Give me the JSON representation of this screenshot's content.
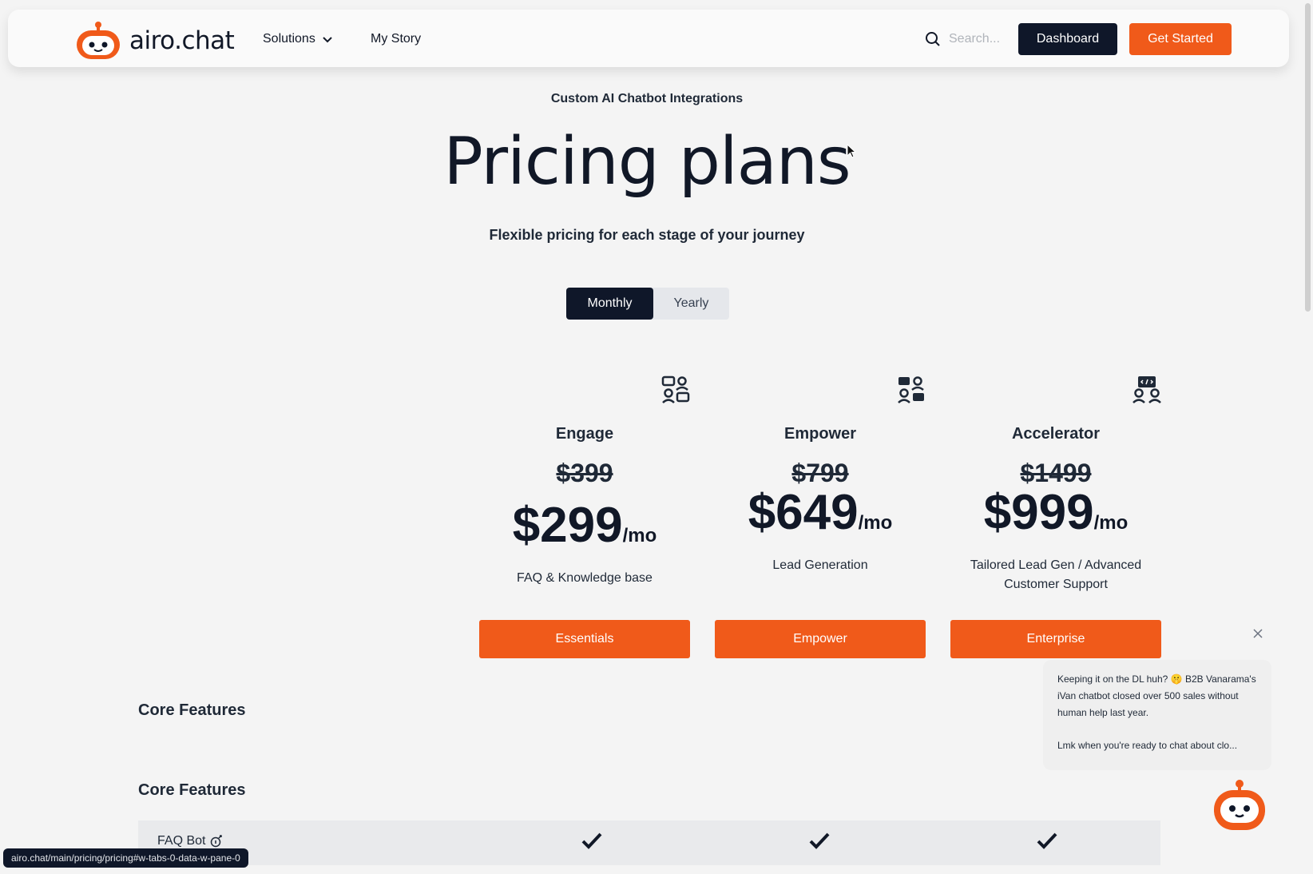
{
  "nav": {
    "brand": "airo.chat",
    "solutions_label": "Solutions",
    "my_story_label": "My Story",
    "search_placeholder": "Search...",
    "dashboard_label": "Dashboard",
    "get_started_label": "Get Started"
  },
  "hero": {
    "eyebrow": "Custom AI Chatbot Integrations",
    "title": "Pricing plans",
    "subtitle": "Flexible pricing for each stage of your journey"
  },
  "billing_toggle": {
    "monthly_label": "Monthly",
    "yearly_label": "Yearly",
    "selected": "Monthly"
  },
  "plans": [
    {
      "name": "Engage",
      "old_price": "$399",
      "price": "$299",
      "period": "/mo",
      "description": "FAQ & Knowledge base",
      "button": "Essentials",
      "icon": "team-chat-icon"
    },
    {
      "name": "Empower",
      "old_price": "$799",
      "price": "$649",
      "period": "/mo",
      "description": "Lead Generation",
      "button": "Empower",
      "icon": "team-chat-icon"
    },
    {
      "name": "Accelerator",
      "old_price": "$1499",
      "price": "$999",
      "period": "/mo",
      "description": "Tailored Lead Gen / Advanced Customer Support",
      "button": "Enterprise",
      "icon": "team-code-icon"
    }
  ],
  "sections": {
    "core_features_1": "Core Features",
    "core_features_2": "Core Features"
  },
  "features": [
    {
      "label": "FAQ Bot",
      "engage": true,
      "empower": true,
      "accelerator": true
    }
  ],
  "status_bar_url": "airo.chat/main/pricing/pricing#w-tabs-0-data-w-pane-0",
  "chat_popup": {
    "message_line1": "Keeping it on the DL huh? 🤫 B2B Vanarama's iVan chatbot closed over 500 sales without human help last year.",
    "message_line2": "Lmk when you're ready to chat about clo..."
  },
  "colors": {
    "accent_orange": "#f05a1a",
    "dark_navy": "#0f1729",
    "background": "#f4f4f4"
  }
}
